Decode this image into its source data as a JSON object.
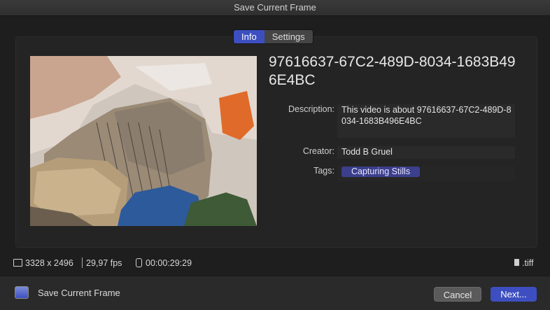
{
  "window": {
    "title": "Save Current Frame"
  },
  "tabs": [
    {
      "label": "Info",
      "active": true
    },
    {
      "label": "Settings",
      "active": false
    }
  ],
  "clip": {
    "title": "97616637-67C2-489D-8034-1683B496E4BC",
    "fields": {
      "description_label": "Description:",
      "description_value": "This video is about 97616637-67C2-489D-8034-1683B496E4BC",
      "creator_label": "Creator:",
      "creator_value": "Todd B Gruel",
      "tags_label": "Tags:",
      "tag": "Capturing Stills"
    }
  },
  "status": {
    "resolution": "3328 x 2496",
    "fps": "29,97 fps",
    "duration": "00:00:29:29",
    "file_type": ".tiff"
  },
  "footer": {
    "destination_label": "Save Current Frame",
    "cancel_label": "Cancel",
    "next_label": "Next..."
  },
  "colors": {
    "accent": "#3d4fc0",
    "tag": "#3c3f8c"
  }
}
